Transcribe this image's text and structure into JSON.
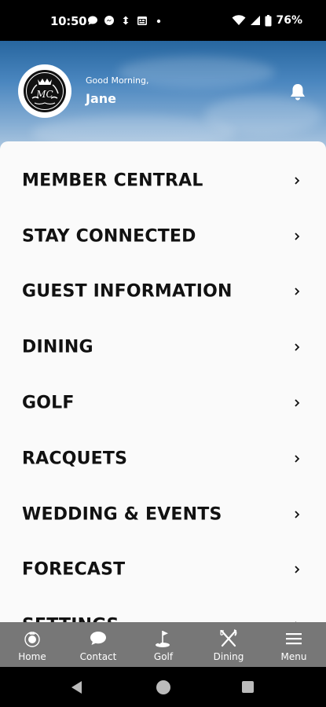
{
  "status_bar": {
    "time": "10:50",
    "battery": "76%"
  },
  "header": {
    "greeting": "Good Morning,",
    "user_name": "Jane",
    "logo_monogram": "MC"
  },
  "menu": {
    "items": [
      {
        "label": "MEMBER CENTRAL"
      },
      {
        "label": "STAY CONNECTED"
      },
      {
        "label": "GUEST INFORMATION"
      },
      {
        "label": "DINING"
      },
      {
        "label": "GOLF"
      },
      {
        "label": "RACQUETS"
      },
      {
        "label": "WEDDING & EVENTS"
      },
      {
        "label": "FORECAST"
      },
      {
        "label": "SETTINGS"
      }
    ]
  },
  "tabbar": {
    "tabs": [
      {
        "label": "Home",
        "icon": "home-crest-icon"
      },
      {
        "label": "Contact",
        "icon": "chat-bubble-icon"
      },
      {
        "label": "Golf",
        "icon": "golf-flag-icon"
      },
      {
        "label": "Dining",
        "icon": "fork-knife-icon"
      },
      {
        "label": "Menu",
        "icon": "hamburger-icon"
      }
    ]
  },
  "colors": {
    "header_top": "#27669f",
    "header_bottom": "#b9cfe4",
    "panel_bg": "#fafafa",
    "tabbar_bg": "#777777",
    "menu_text": "#111111"
  }
}
